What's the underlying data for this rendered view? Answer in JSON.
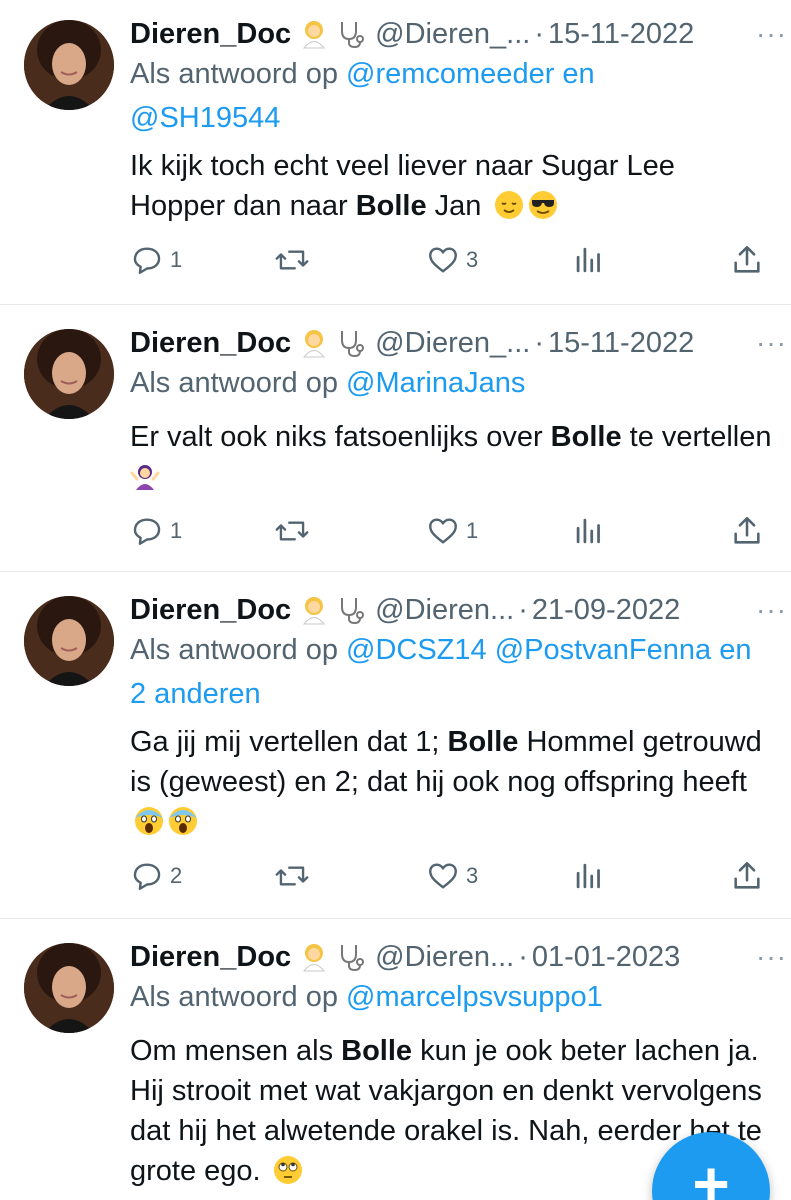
{
  "tweets": [
    {
      "name": "Dieren_Doc",
      "handle": "@Dieren_...",
      "date": "15-11-2022",
      "reply_prefix": "Als antwoord op ",
      "reply_mentions_1": "@remcomeeder en",
      "reply_line_2": "@SH19544",
      "text_a": "Ik kijk toch echt veel liever naar Sugar Lee Hopper dan naar ",
      "text_bold": "Bolle",
      "text_b": " Jan",
      "emojis": [
        "relieved-face-emoji",
        "sunglasses-face-emoji"
      ],
      "replies": "1",
      "retweets": "",
      "likes": "3"
    },
    {
      "name": "Dieren_Doc",
      "handle": "@Dieren_...",
      "date": "15-11-2022",
      "reply_prefix": "Als antwoord op ",
      "reply_mentions_1": "@MarinaJans",
      "text_a": "Er valt ook niks fatsoenlijks over ",
      "text_bold": "Bolle",
      "text_b": " te vertellen",
      "emojis": [
        "woman-shrugging-emoji"
      ],
      "replies": "1",
      "retweets": "",
      "likes": "1"
    },
    {
      "name": "Dieren_Doc",
      "handle": "@Dieren...",
      "date": "21-09-2022",
      "reply_prefix": "Als antwoord op ",
      "reply_mentions_1": "@DCSZ14 @PostvanFenna en",
      "reply_line_2": "2 anderen",
      "text_a": "Ga jij mij vertellen dat 1; ",
      "text_bold": "Bolle",
      "text_b": " Hommel getrouwd is (geweest) en 2; dat hij ook nog offspring heeft",
      "emojis": [
        "face-screaming-emoji",
        "face-screaming-emoji"
      ],
      "replies": "2",
      "retweets": "",
      "likes": "3"
    },
    {
      "name": "Dieren_Doc",
      "handle": "@Dieren...",
      "date": "01-01-2023",
      "reply_prefix": "Als antwoord op ",
      "reply_mentions_1": "@marcelpsvsuppo1",
      "text_a": "Om mensen als ",
      "text_bold": "Bolle",
      "text_b": " kun je ook beter lachen ja. Hij strooit met wat vakjargon en denkt vervolgens dat hij het alwetende orakel is. Nah, eerder het te grote ego.",
      "emojis": [
        "eye-roll-face-emoji"
      ]
    }
  ],
  "separator": "·",
  "more_label": "···",
  "fab_label": "+",
  "colors": {
    "accent": "#1d9bf0",
    "secondary_text": "#536471",
    "primary_text": "#0f1419"
  },
  "icons": [
    "reply-icon",
    "retweet-icon",
    "like-icon",
    "views-icon",
    "share-icon",
    "woman-health-worker-emoji",
    "stethoscope-emoji"
  ]
}
